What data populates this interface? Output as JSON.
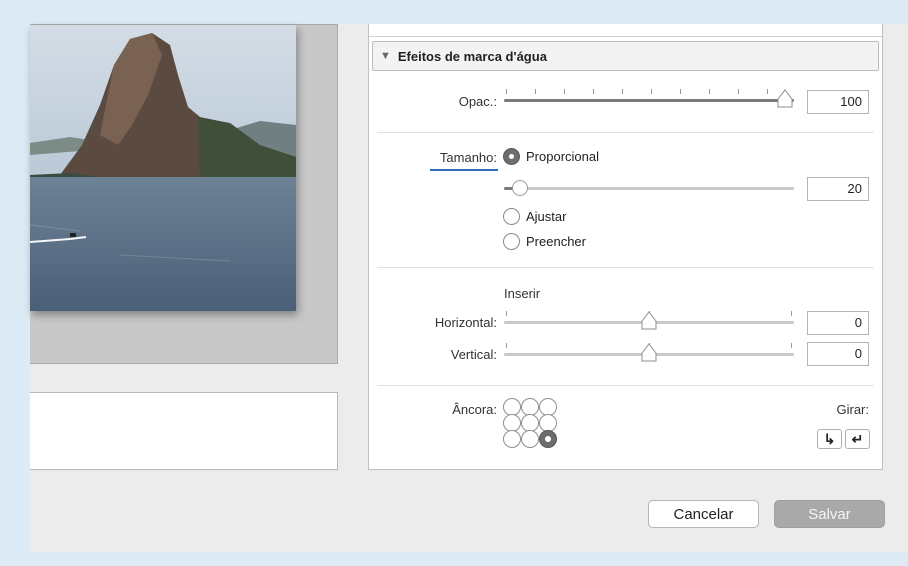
{
  "watermark_section": {
    "title": "Efeitos de marca d'água"
  },
  "opacity": {
    "label": "Opac.:",
    "value": "100",
    "level": 1.0
  },
  "size": {
    "label": "Tamanho:",
    "options": [
      "Proporcional",
      "Ajustar",
      "Preencher"
    ],
    "selected": "Proporcional",
    "value": "20",
    "level": 0.05
  },
  "inset": {
    "heading": "Inserir",
    "horizontal_label": "Horizontal:",
    "horizontal_value": "0",
    "vertical_label": "Vertical:",
    "vertical_value": "0"
  },
  "anchor": {
    "label": "Âncora:",
    "selected": "bottom-right"
  },
  "rotate": {
    "label": "Girar:",
    "right_icon": "rotate-right-icon",
    "left_icon": "rotate-left-icon"
  },
  "footer": {
    "cancel_label": "Cancelar",
    "save_label": "Salvar"
  },
  "colors": {
    "outer_background": "#dcebf6",
    "dialog_background": "#ececec",
    "save_disabled": "#a9a9a9",
    "focus_underline": "#2f6fb5"
  }
}
